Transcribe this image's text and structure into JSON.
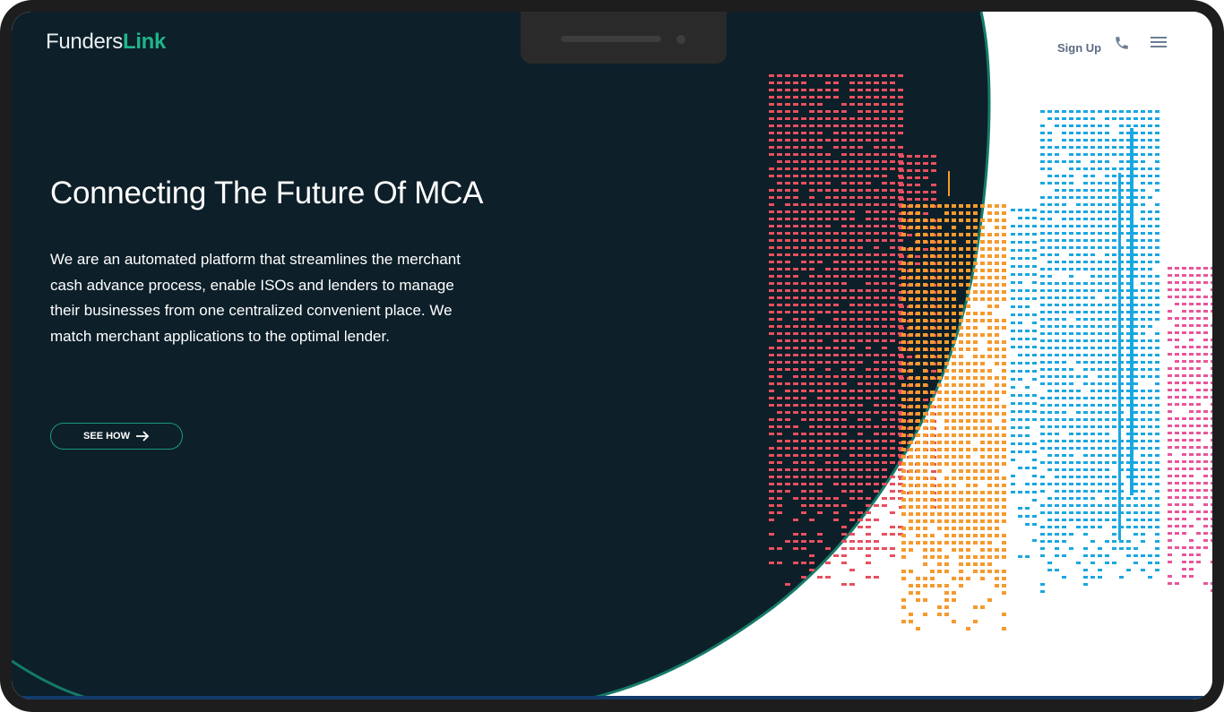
{
  "brand": {
    "logo_part1": "Funders",
    "logo_part2": "Link",
    "accent_color": "#1fb58a",
    "dark_bg": "#0d1f29"
  },
  "nav": {
    "signup_label": "Sign Up",
    "phone_icon": "phone-icon",
    "menu_icon": "hamburger-menu-icon"
  },
  "hero": {
    "title": "Connecting The Future Of MCA",
    "description": "We are an automated platform that streamlines the merchant cash advance process, enable ISOs and lenders to manage their businesses from one centralized convenient place. We match merchant applications to the optimal lender.",
    "cta_label": "SEE HOW",
    "cta_icon": "arrow-right-icon"
  },
  "illustration": {
    "name": "city-skyline-illustration",
    "colors": [
      "#e8505f",
      "#f59a2f",
      "#1aa7e0",
      "#e8559a"
    ]
  }
}
